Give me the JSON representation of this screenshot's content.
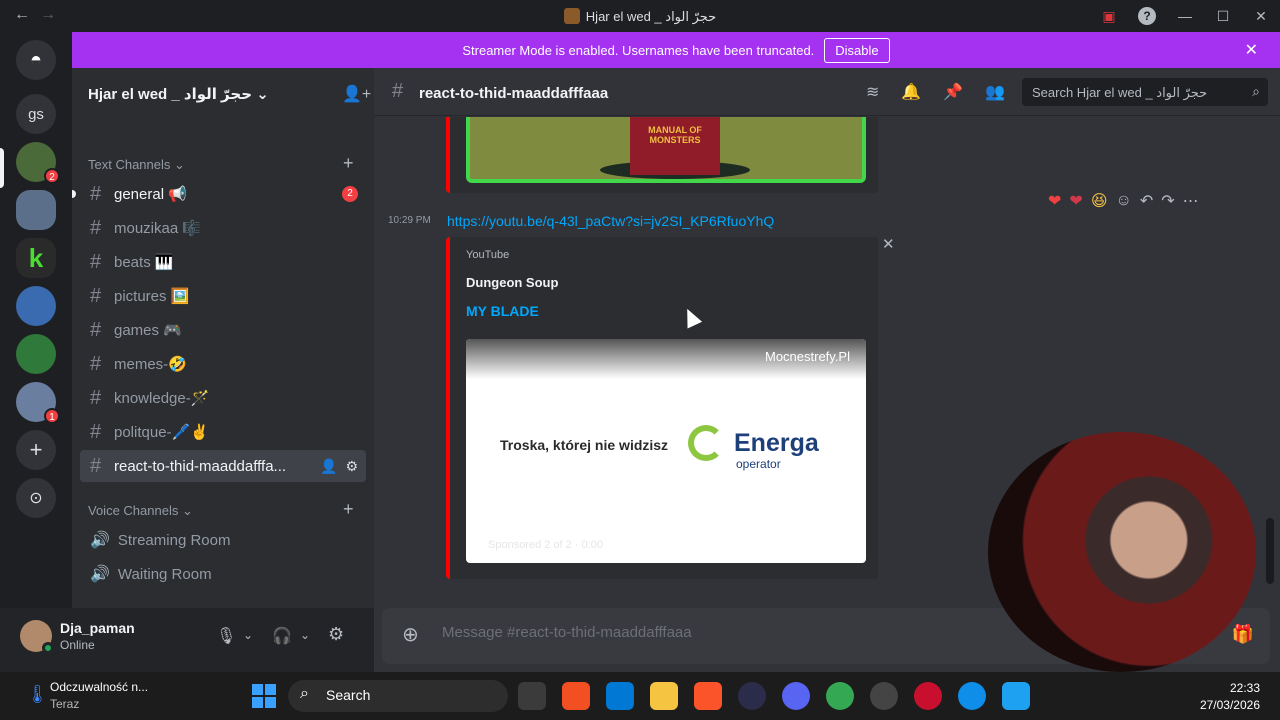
{
  "window": {
    "title": "Hjar el wed _ حجرّ الواد",
    "controls": [
      "minimize",
      "maximize",
      "close"
    ]
  },
  "banner": {
    "text": "Streamer Mode is enabled. Usernames have been truncated.",
    "button": "Disable",
    "color": "#a432f0"
  },
  "guilds": [
    {
      "label": "gs",
      "badge": ""
    },
    {
      "label": "",
      "badge": "2"
    },
    {
      "label": "",
      "badge": ""
    },
    {
      "label": "",
      "badge": ""
    },
    {
      "label": "",
      "badge": ""
    },
    {
      "label": "",
      "badge": ""
    },
    {
      "label": "",
      "badge": "1"
    }
  ],
  "sidebar": {
    "server_name": "Hjar el wed _ حجرّ الواد",
    "text_category": "Text Channels",
    "voice_category": "Voice Channels",
    "channels": [
      {
        "name": "general 📢",
        "mention": "2"
      },
      {
        "name": "mouzikaa 🎼"
      },
      {
        "name": "beats 🎹"
      },
      {
        "name": "pictures 🖼️"
      },
      {
        "name": "games 🎮"
      },
      {
        "name": "memes-🤣"
      },
      {
        "name": "knowledge-🪄"
      },
      {
        "name": "politque-🖊️✌️"
      },
      {
        "name": "react-to-thid-maaddafffa..."
      }
    ],
    "voice_channels": [
      "Streaming Room",
      "Waiting Room"
    ]
  },
  "user": {
    "name": "Dja_paman",
    "status": "Online"
  },
  "channel_header": {
    "name": "react-to-thid-maaddafffaaa",
    "search_placeholder": "Search Hjar el wed _ حجرّ الواد"
  },
  "messages": {
    "cartoon_book_text": "MANUAL OF MONSTERS",
    "time": "10:29 PM",
    "link": "https://youtu.be/q-43l_paCtw?si=jv2SI_KP6RfuoYhQ",
    "embed": {
      "provider": "YouTube",
      "author": "Dungeon Soup",
      "title": "MY BLADE",
      "video_site": "Mocnestrefy.Pl",
      "ad_tagline": "Troska, której nie widzisz",
      "ad_brand": "Energa",
      "ad_brand_sub": "operator",
      "ad_overlay": "Sponsored 2 of 2 · 0:00"
    }
  },
  "composer": {
    "placeholder": "Message #react-to-thid-maaddafffaaa"
  },
  "taskbar": {
    "weather_title": "Odczuwalność n...",
    "weather_sub": "Teraz",
    "search": "Search",
    "time": "22:33",
    "date": "27/03/2026"
  }
}
